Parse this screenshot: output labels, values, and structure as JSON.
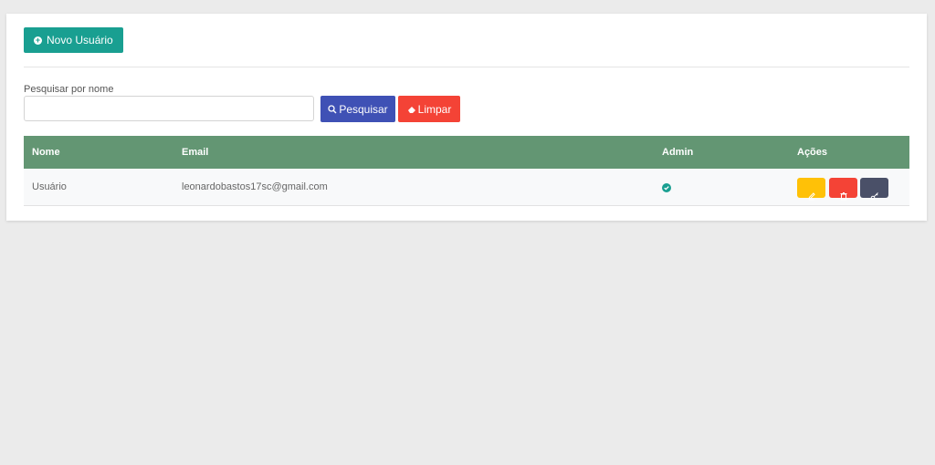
{
  "toolbar": {
    "new_user_label": "Novo Usuário",
    "new_user_icon": "plus-circle-icon"
  },
  "search": {
    "label": "Pesquisar por nome",
    "value": "",
    "placeholder": "",
    "search_button": "Pesquisar",
    "clear_button": "Limpar"
  },
  "table": {
    "columns": [
      "Nome",
      "Email",
      "Admin",
      "Ações"
    ],
    "rows": [
      {
        "nome": "Usuário",
        "email": "leonardobastos17sc@gmail.com",
        "admin": true,
        "actions": [
          "edit-icon",
          "trash-icon",
          "key-icon"
        ]
      }
    ]
  },
  "colors": {
    "primary": "#199f91",
    "header": "#639673",
    "search": "#3f51b5",
    "danger": "#f44336",
    "warning": "#ffc107",
    "dark": "#4a5068"
  }
}
